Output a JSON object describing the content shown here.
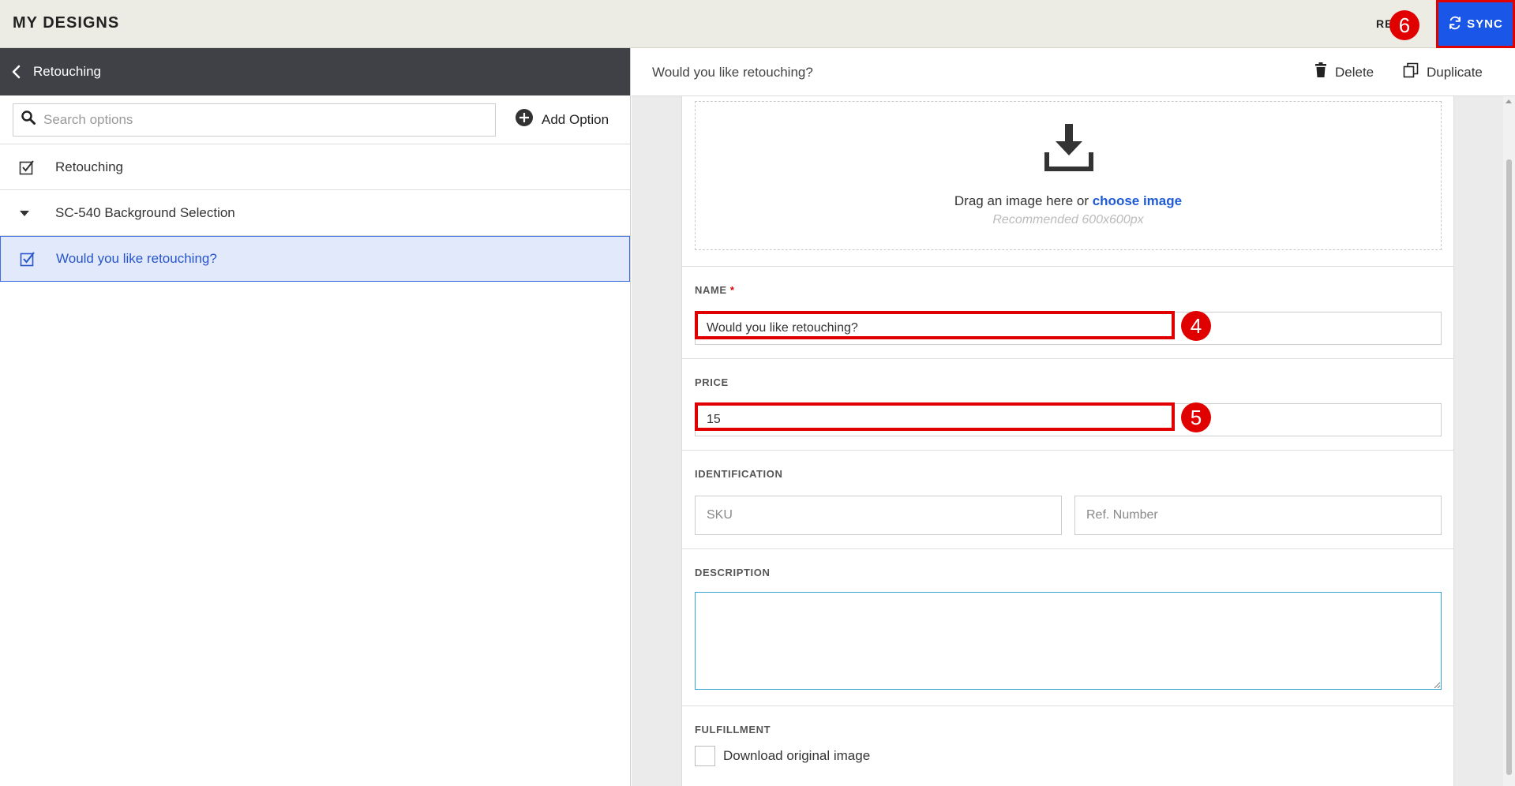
{
  "topbar": {
    "title": "MY DESIGNS",
    "reset_label": "RESET",
    "sync_label": "SYNC"
  },
  "markers": {
    "m4": "4",
    "m5": "5",
    "m6": "6"
  },
  "sidebar": {
    "header": "Retouching",
    "search_placeholder": "Search options",
    "add_option": "Add Option",
    "items": [
      {
        "label": "Retouching",
        "icon": "checkbox-icon"
      },
      {
        "label": "SC-540 Background Selection",
        "icon": "caret-down-icon"
      },
      {
        "label": "Would you like retouching?",
        "icon": "checkbox-icon"
      }
    ]
  },
  "detail": {
    "title": "Would you like retouching?",
    "delete_label": "Delete",
    "duplicate_label": "Duplicate",
    "dropzone": {
      "text": "Drag an image here or ",
      "link": "choose image",
      "hint": "Recommended 600x600px"
    },
    "name_label": "NAME",
    "name_required": "*",
    "name_value": "Would you like retouching?",
    "price_label": "PRICE",
    "price_value": "15",
    "identification_label": "IDENTIFICATION",
    "sku_placeholder": "SKU",
    "ref_placeholder": "Ref. Number",
    "description_label": "DESCRIPTION",
    "fulfillment_label": "FULFILLMENT",
    "download_label": "Download original image"
  },
  "colors": {
    "accent": "#1a56e8",
    "highlight": "#e00000",
    "selected_bg": "#e1e9fb",
    "header_dark": "#3f4146"
  }
}
